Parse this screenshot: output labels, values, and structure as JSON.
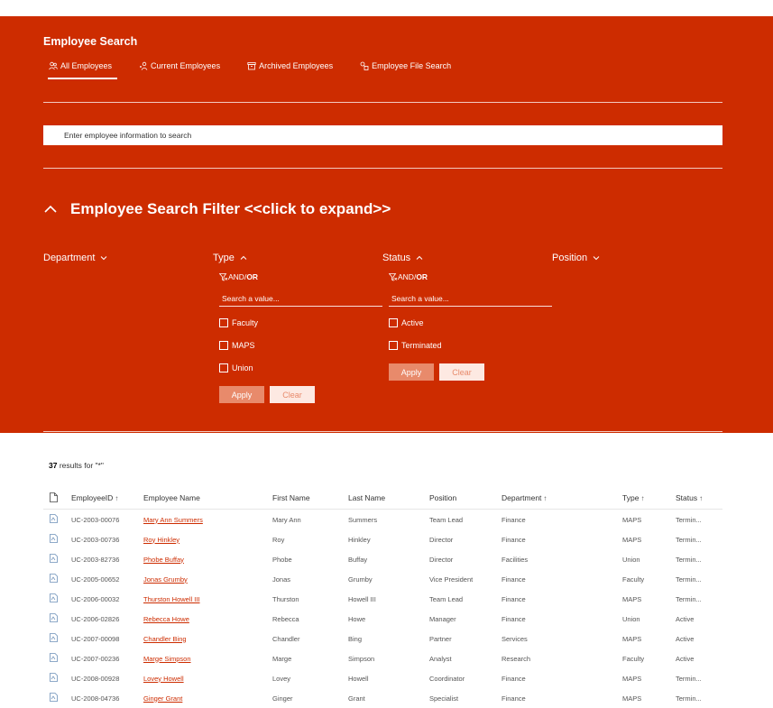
{
  "header": {
    "title": "Employee Search"
  },
  "tabs": [
    {
      "label": "All Employees",
      "icon": "people-icon",
      "active": true
    },
    {
      "label": "Current Employees",
      "icon": "person-group-icon",
      "active": false
    },
    {
      "label": "Archived Employees",
      "icon": "archive-icon",
      "active": false
    },
    {
      "label": "Employee File Search",
      "icon": "file-search-icon",
      "active": false
    }
  ],
  "search": {
    "placeholder": "Enter employee information to search",
    "value": ""
  },
  "filter": {
    "title": "Employee Search Filter <<click to expand>>"
  },
  "facets": {
    "department": {
      "label": "Department"
    },
    "type": {
      "label": "Type",
      "and": "AND/",
      "or": "OR",
      "placeholder": "Search a value...",
      "options": [
        "Faculty",
        "MAPS",
        "Union"
      ],
      "apply": "Apply",
      "clear": "Clear"
    },
    "status": {
      "label": "Status",
      "and": "AND/",
      "or": "OR",
      "placeholder": "Search a value...",
      "options": [
        "Active",
        "Terminated"
      ],
      "apply": "Apply",
      "clear": "Clear"
    },
    "position": {
      "label": "Position"
    }
  },
  "results": {
    "count": "37",
    "text": " results for \"*\""
  },
  "table": {
    "columns": [
      "EmployeeID",
      "Employee Name",
      "First Name",
      "Last Name",
      "Position",
      "Department",
      "Type",
      "Status"
    ],
    "sorted": {
      "EmployeeID": "↑",
      "Department": "↑",
      "Type": "↑",
      "Status": "↑"
    },
    "rows": [
      [
        "UC-2003-00076",
        "Mary Ann Summers",
        "Mary Ann",
        "Summers",
        "Team Lead",
        "Finance",
        "MAPS",
        "Termin..."
      ],
      [
        "UC-2003-00736",
        "Roy Hinkley",
        "Roy",
        "Hinkley",
        "Director",
        "Finance",
        "MAPS",
        "Termin..."
      ],
      [
        "UC-2003-82736",
        "Phobe Buffay",
        "Phobe",
        "Buffay",
        "Director",
        "Facilities",
        "Union",
        "Termin..."
      ],
      [
        "UC-2005-00652",
        "Jonas Grumby",
        "Jonas",
        "Grumby",
        "Vice President",
        "Finance",
        "Faculty",
        "Termin..."
      ],
      [
        "UC-2006-00032",
        "Thurston Howell III",
        "Thurston",
        "Howell III",
        "Team Lead",
        "Finance",
        "MAPS",
        "Termin..."
      ],
      [
        "UC-2006-02826",
        "Rebecca Howe",
        "Rebecca",
        "Howe",
        "Manager",
        "Finance",
        "Union",
        "Active"
      ],
      [
        "UC-2007-00098",
        "Chandler Bing",
        "Chandler",
        "Bing",
        "Partner",
        "Services",
        "MAPS",
        "Active"
      ],
      [
        "UC-2007-00236",
        "Marge Simpson",
        "Marge",
        "Simpson",
        "Analyst",
        "Research",
        "Faculty",
        "Active"
      ],
      [
        "UC-2008-00928",
        "Lovey Howell",
        "Lovey",
        "Howell",
        "Coordinator",
        "Finance",
        "MAPS",
        "Termin..."
      ],
      [
        "UC-2008-04736",
        "Ginger Grant",
        "Ginger",
        "Grant",
        "Specialist",
        "Finance",
        "MAPS",
        "Termin..."
      ]
    ]
  }
}
